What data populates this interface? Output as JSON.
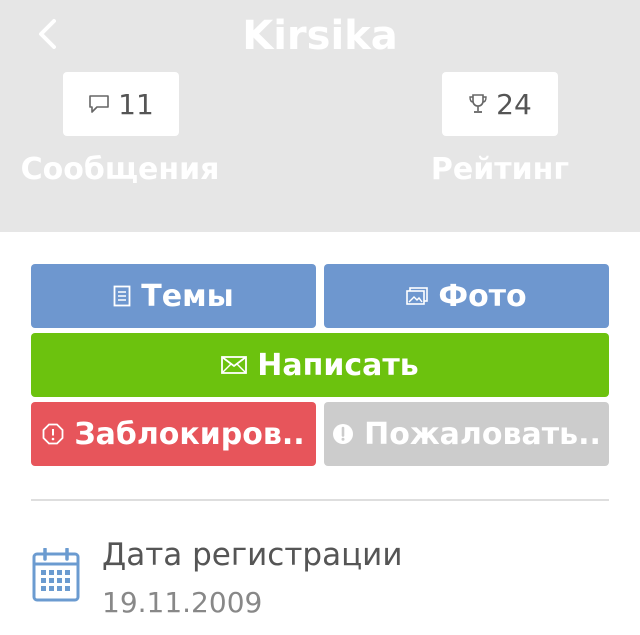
{
  "header": {
    "title": "Kirsika",
    "messages": {
      "count": "11",
      "label": "Сообщения",
      "icon": "speech-bubble-icon"
    },
    "rating": {
      "count": "24",
      "label": "Рейтинг",
      "icon": "trophy-icon"
    }
  },
  "actions": {
    "topics": {
      "label": "Темы",
      "icon": "document-icon",
      "color": "#6e97cf"
    },
    "photo": {
      "label": "Фото",
      "icon": "photo-icon",
      "color": "#6e97cf"
    },
    "write": {
      "label": "Написать",
      "icon": "envelope-icon",
      "color": "#6cc20e"
    },
    "block": {
      "label": "Заблокиров..",
      "icon": "stop-octagon-icon",
      "color": "#e7555b"
    },
    "report": {
      "label": "Пожаловать..",
      "icon": "exclamation-icon",
      "color": "#cccccc"
    }
  },
  "registration": {
    "label": "Дата регистрации",
    "value": "19.11.2009",
    "icon": "calendar-icon"
  }
}
